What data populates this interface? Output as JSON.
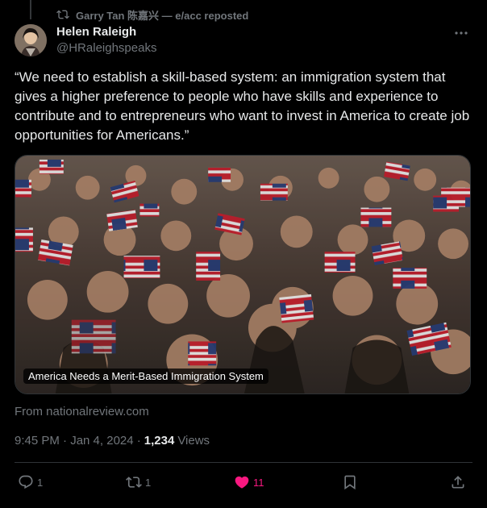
{
  "repost": {
    "text": "Garry Tan 陈嘉兴 — e/acc reposted"
  },
  "author": {
    "name": "Helen Raleigh",
    "handle": "@HRaleighspeaks"
  },
  "tweet": {
    "text": "“We need to establish a skill-based system: an immigration system that gives a higher preference to people who have skills and experience to contribute and to entrepreneurs who want to invest in America to create job opportunities for Americans.”"
  },
  "media": {
    "caption": "America Needs a Merit-Based Immigration System"
  },
  "link": {
    "source": "From nationalreview.com"
  },
  "meta": {
    "time": "9:45 PM · Jan 4, 2024 ·",
    "views_count": "1,234",
    "views_label": "Views"
  },
  "actions": {
    "replies": "1",
    "reposts": "1",
    "likes": "11"
  },
  "colors": {
    "background": "#000000",
    "text": "#e7e9ea",
    "muted": "#71767b",
    "like": "#f91880"
  }
}
